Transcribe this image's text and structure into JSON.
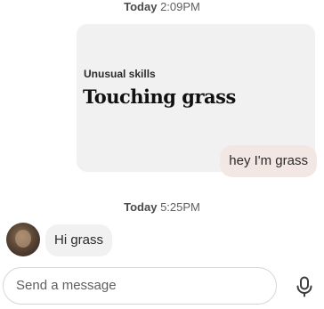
{
  "conversation": {
    "timestamp_1": {
      "day": "Today",
      "time": "2:09PM"
    },
    "shared_card": {
      "eyebrow": "Unusual skills",
      "title": "Touching grass",
      "background": "#f1f1f1"
    },
    "outgoing_message": {
      "text": "hey I'm grass",
      "bubble_color": "#f3e7e3"
    },
    "timestamp_2": {
      "day": "Today",
      "time": "5:25PM"
    },
    "incoming_message": {
      "text": "Hi grass",
      "bubble_color": "#f1f1f1"
    }
  },
  "composer": {
    "placeholder": "Send a message",
    "mic_icon": "microphone-icon"
  }
}
